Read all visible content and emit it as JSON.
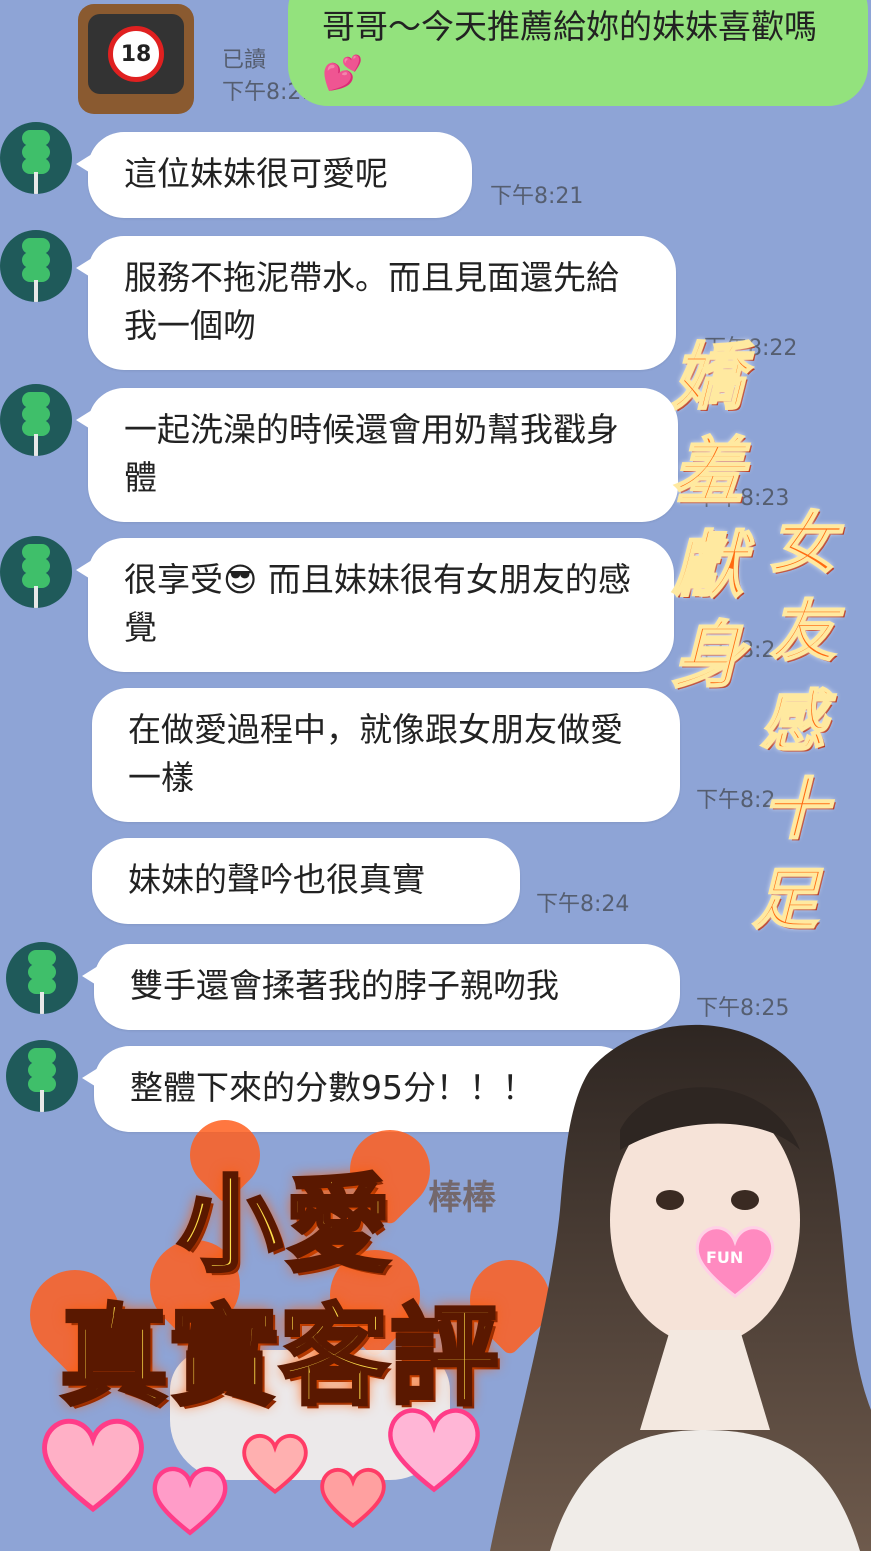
{
  "outgoing": {
    "text": "哥哥～今天推薦給妳的妹妹喜歡嗎💕",
    "read_label": "已讀",
    "time": "下午8:21"
  },
  "profile_icon": {
    "name": "tv-18-icon",
    "text": "18"
  },
  "messages": [
    {
      "text": "這位妹妹很可愛呢",
      "time": "下午8:21"
    },
    {
      "text": "服務不拖泥帶水。而且見面還先給我一個吻",
      "time": "下午8:22"
    },
    {
      "text": "一起洗澡的時候還會用奶幫我戳身體",
      "time": "下午8:23"
    },
    {
      "text": "很享受😎  而且妹妹很有女朋友的感覺",
      "time": "下午8:2"
    },
    {
      "text": "在做愛過程中，就像跟女朋友做愛一樣",
      "time": "下午8:2"
    },
    {
      "text": "妹妹的聲吟也很真實",
      "time": "下午8:24"
    },
    {
      "text": "雙手還會揉著我的脖子親吻我",
      "time": "下午8:25"
    },
    {
      "text": "整體下來的分數95分！！！",
      "time": ""
    }
  ],
  "overlay": {
    "left_text": [
      "嬌",
      "羞",
      "獻",
      "身"
    ],
    "right_text": [
      "女",
      "友",
      "感",
      "十",
      "足"
    ],
    "banner_line1": "小愛",
    "banner_line2": "真實客評",
    "sticker_text": "棒棒",
    "heart_label": "FUN"
  },
  "colors": {
    "background": "#8ea4d6",
    "outgoing_bubble": "#93e27d",
    "incoming_bubble": "#ffffff"
  }
}
